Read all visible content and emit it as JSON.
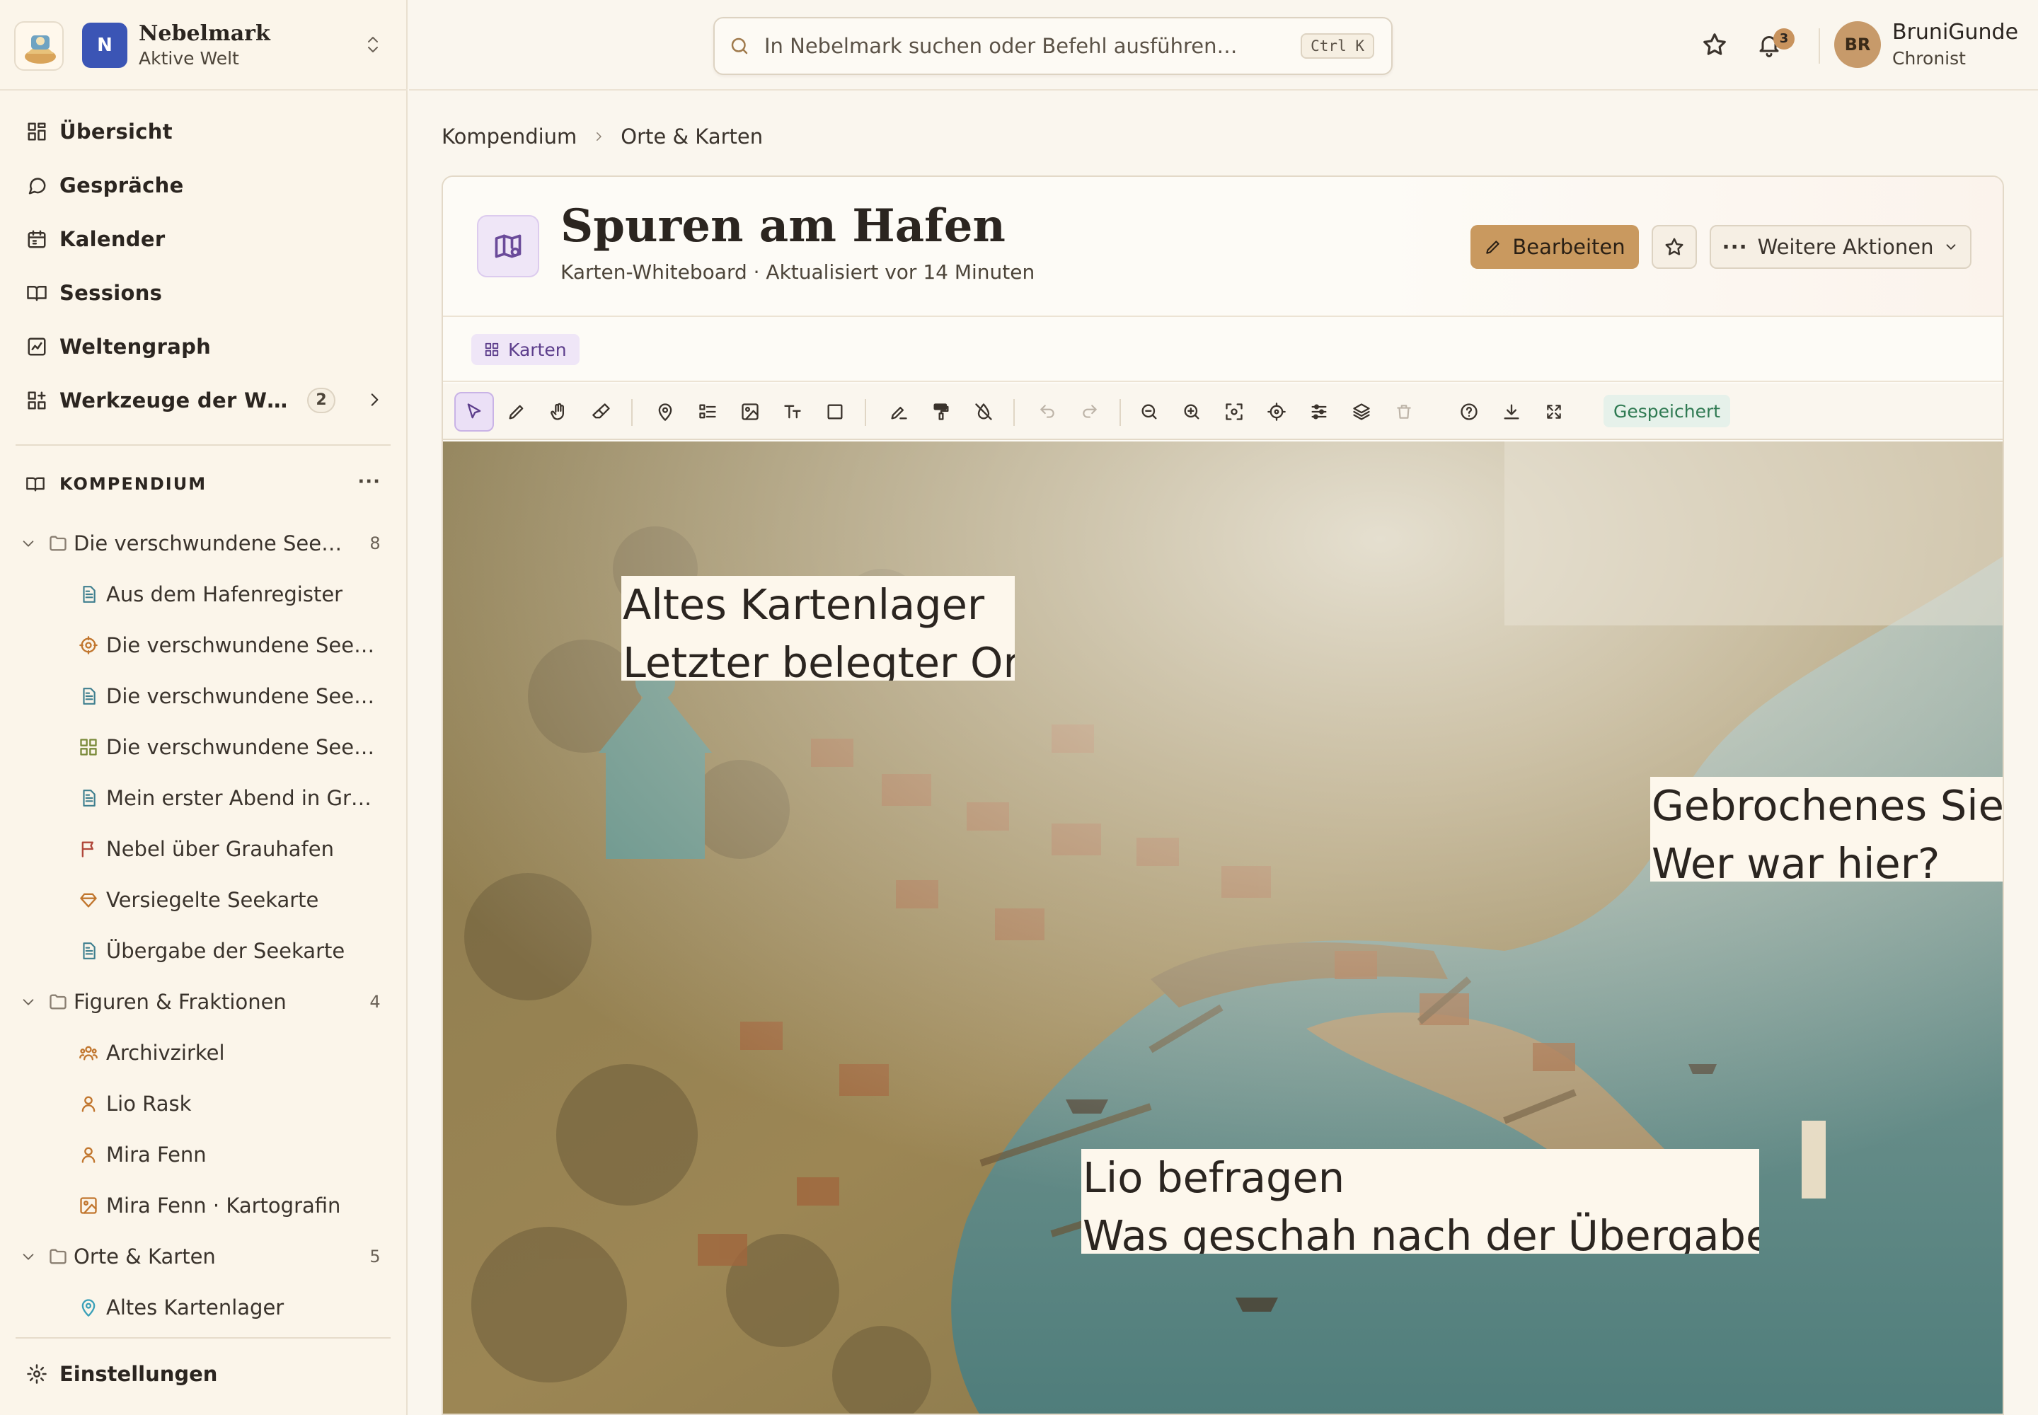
{
  "workspace": {
    "badge": "N",
    "name": "Nebelmark",
    "status": "Aktive Welt"
  },
  "nav": [
    {
      "label": "Übersicht",
      "icon": "grid-icon"
    },
    {
      "label": "Gespräche",
      "icon": "chat-icon"
    },
    {
      "label": "Kalender",
      "icon": "calendar-icon"
    },
    {
      "label": "Sessions",
      "icon": "book-icon"
    },
    {
      "label": "Weltengraph",
      "icon": "chart-icon"
    },
    {
      "label": "Werkzeuge der W…",
      "icon": "tools-icon",
      "count": "2"
    }
  ],
  "compendium": {
    "title": "KOMPENDIUM",
    "more": "···",
    "groups": [
      {
        "name": "Die verschwundene See…",
        "count": "8"
      },
      {
        "name": "Figuren & Fraktionen",
        "count": "4"
      },
      {
        "name": "Orte & Karten",
        "count": "5"
      }
    ],
    "items": [
      {
        "label": "Aus dem Hafenregister",
        "icon": "document-icon",
        "color": "#3f7f8f"
      },
      {
        "label": "Die verschwundene See…",
        "icon": "target-icon",
        "color": "#c1762e"
      },
      {
        "label": "Die verschwundene See…",
        "icon": "document-icon",
        "color": "#3f7f8f"
      },
      {
        "label": "Die verschwundene See…",
        "icon": "board-icon",
        "color": "#7a8a3a"
      },
      {
        "label": "Mein erster Abend in Gr…",
        "icon": "document-icon",
        "color": "#3f7f8f"
      },
      {
        "label": "Nebel über Grauhafen",
        "icon": "flag-icon",
        "color": "#b0473a"
      },
      {
        "label": "Versiegelte Seekarte",
        "icon": "gem-icon",
        "color": "#c1762e"
      },
      {
        "label": "Übergabe der Seekarte",
        "icon": "document-icon",
        "color": "#3f7f8f"
      },
      {
        "label": "Archivzirkel",
        "icon": "group-icon",
        "color": "#c1762e"
      },
      {
        "label": "Lio Rask",
        "icon": "person-icon",
        "color": "#c1762e"
      },
      {
        "label": "Mira Fenn",
        "icon": "person-icon",
        "color": "#c1762e"
      },
      {
        "label": "Mira Fenn · Kartografin",
        "icon": "image-icon",
        "color": "#c1762e"
      },
      {
        "label": "Altes Kartenlager",
        "icon": "pin-icon",
        "color": "#3aa0b8"
      }
    ]
  },
  "settings": {
    "label": "Einstellungen"
  },
  "search": {
    "placeholder": "In Nebelmark suchen oder Befehl ausführen…",
    "shortcut": "Ctrl K"
  },
  "user": {
    "initials": "BR",
    "name": "BruniGunde",
    "role": "Chronist",
    "notifications": "3"
  },
  "breadcrumb": [
    "Kompendium",
    "Orte & Karten"
  ],
  "page": {
    "title": "Spuren am Hafen",
    "subtitle": "Karten-Whiteboard · Aktualisiert vor 14 Minuten",
    "edit_label": "Bearbeiten",
    "more_label": "Weitere Aktionen",
    "tag": "Karten"
  },
  "toolbar": {
    "status": "Gespeichert"
  },
  "notes": [
    {
      "line1": "Altes Kartenlager",
      "line2": "Letzter belegter Ort"
    },
    {
      "line1": "Gebrochenes Siegel",
      "line2": "Wer war hier?"
    },
    {
      "line1": "Lio befragen",
      "line2": "Was geschah nach der Übergabe?"
    }
  ],
  "colors": {
    "accent": "#c9995f",
    "brand": "#3b55b5",
    "tag": "#efe6f7",
    "saved": "#2f7a52"
  }
}
